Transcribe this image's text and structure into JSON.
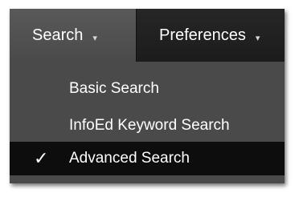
{
  "menubar": {
    "search_label": "Search",
    "search_arrow": "▾",
    "preferences_label": "Preferences",
    "preferences_arrow": "▾"
  },
  "dropdown": {
    "items": [
      {
        "label": "Basic Search",
        "selected": false
      },
      {
        "label": "InfoEd Keyword Search",
        "selected": false
      },
      {
        "label": "Advanced Search",
        "selected": true
      }
    ],
    "check_glyph": "✓"
  },
  "icons": {
    "selected_marker": "checkmark-icon",
    "menu_arrow": "chevron-down-icon"
  }
}
